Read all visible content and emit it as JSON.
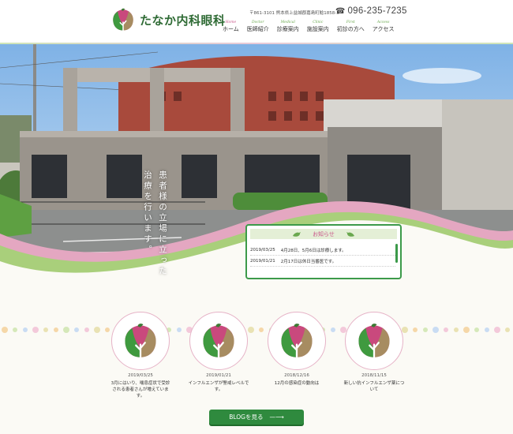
{
  "header": {
    "logo_text": "たなか内科眼科",
    "address": "〒861-3101 熊本県上益城郡嘉島町鯰1858-3",
    "tel": "096-235-7235"
  },
  "nav": [
    {
      "sub": "Home",
      "label": "ホーム"
    },
    {
      "sub": "Doctor",
      "label": "医師紹介"
    },
    {
      "sub": "Medical",
      "label": "診療案内"
    },
    {
      "sub": "Clinic",
      "label": "施設案内"
    },
    {
      "sub": "First",
      "label": "初診の方へ"
    },
    {
      "sub": "Access",
      "label": "アクセス"
    }
  ],
  "hero": {
    "catch_col1": "患者様の立場に立った",
    "catch_col2": "治療を行います。"
  },
  "news": {
    "title": "お知らせ",
    "items": [
      {
        "date": "2019/03/25",
        "text": "4月28日、5月6日は診療します。"
      },
      {
        "date": "2019/01/21",
        "text": "2月17日は休日当番医です。"
      }
    ]
  },
  "blog": [
    {
      "date": "2019/03/25",
      "text": "3月にはいり、喘息症状で受診される患者さんが増えています。"
    },
    {
      "date": "2019/01/21",
      "text": "インフルエンザが警戒レベルです。"
    },
    {
      "date": "2018/12/16",
      "text": "12月の感染症の動向は"
    },
    {
      "date": "2018/11/15",
      "text": "新しい抗インフルエンザ薬について"
    }
  ],
  "blog_button": "BLOGを見る",
  "colors": {
    "brand_green": "#2f8a3e",
    "accent_pink": "#c9568a"
  }
}
